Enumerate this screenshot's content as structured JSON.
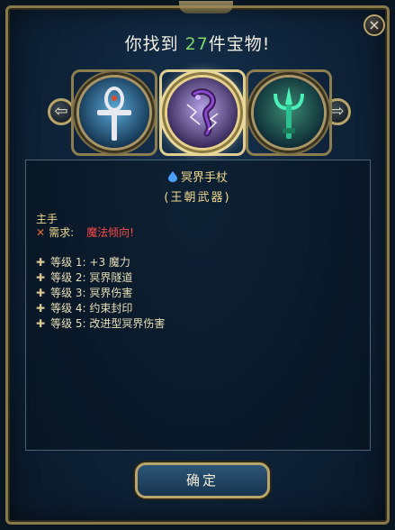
{
  "dialog": {
    "title_prefix": "你找到 ",
    "title_count": "27",
    "title_suffix": "件宝物!",
    "close_label": "×"
  },
  "carousel": {
    "prev_label": "⇦",
    "next_label": "⇨",
    "items": [
      {
        "icon": "ankh-icon"
      },
      {
        "icon": "purple-staff-icon",
        "selected": true
      },
      {
        "icon": "green-trident-icon"
      }
    ]
  },
  "item": {
    "name": "冥界手杖",
    "type": "(王朝武器)",
    "slot": "主手",
    "requirement_label": "需求:",
    "requirement_value": "魔法倾向!",
    "levels": [
      {
        "label": "等级 1:",
        "effect": "+3 魔力"
      },
      {
        "label": "等级 2:",
        "effect": "冥界隧道"
      },
      {
        "label": "等级 3:",
        "effect": "冥界伤害"
      },
      {
        "label": "等级 4:",
        "effect": "约束封印"
      },
      {
        "label": "等级 5:",
        "effect": "改进型冥界伤害"
      }
    ]
  },
  "confirm_label": "确定",
  "colors": {
    "accent_gold": "#e0cc90",
    "count_green": "#7dd86a",
    "requirement_red": "#ff4a4a"
  }
}
